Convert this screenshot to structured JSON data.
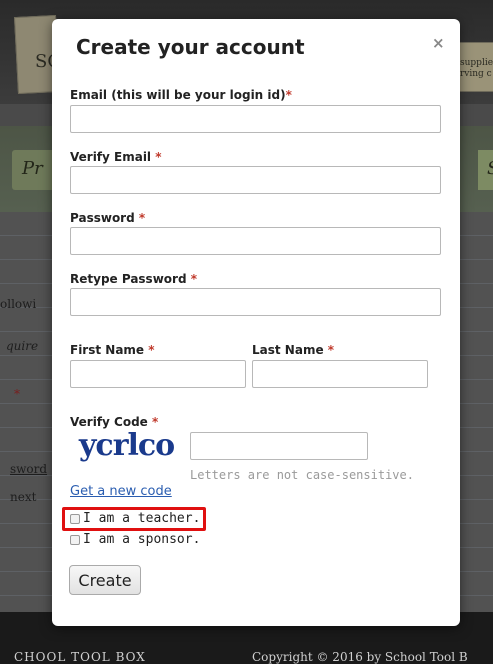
{
  "background": {
    "card_left_text": "SC",
    "card_right_text": "supplie\nrving c",
    "tab_left_text": "Pr",
    "tab_right_text": "S",
    "side_text": [
      "ollowi",
      "quire",
      "*",
      "sword",
      "next"
    ],
    "footer_left": "CHOOL TOOL BOX",
    "footer_right": "Copyright © 2016 by School Tool B"
  },
  "modal": {
    "title": "Create your account",
    "close_label": "×",
    "email": {
      "label": "Email (this will be your login id)",
      "required": "*",
      "value": ""
    },
    "verify_email": {
      "label": "Verify Email ",
      "required": "*",
      "value": ""
    },
    "password": {
      "label": "Password ",
      "required": "*",
      "value": ""
    },
    "retype_password": {
      "label": "Retype Password ",
      "required": "*",
      "value": ""
    },
    "first_name": {
      "label": "First Name ",
      "required": "*",
      "value": ""
    },
    "last_name": {
      "label": "Last Name ",
      "required": "*",
      "value": ""
    },
    "verify_code": {
      "label": "Verify Code ",
      "required": "*",
      "captcha_text": "ycrlco",
      "value": "",
      "hint": "Letters are not case-sensitive.",
      "new_code_link": "Get a new code"
    },
    "checkboxes": [
      {
        "label": "I am a teacher.",
        "checked": false,
        "highlighted": true
      },
      {
        "label": "I am a sponsor.",
        "checked": false,
        "highlighted": false
      }
    ],
    "submit_label": "Create"
  },
  "colors": {
    "highlight": "#e01010",
    "required": "#c0392b",
    "link": "#2a5db0",
    "captcha": "#1a3a8c"
  }
}
